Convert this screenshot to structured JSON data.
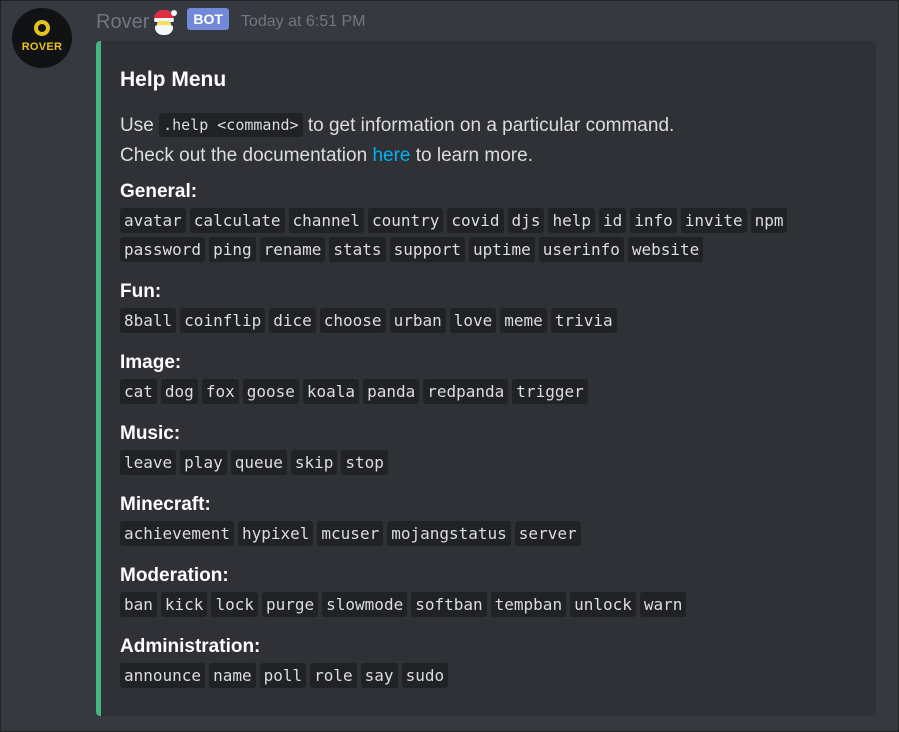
{
  "message": {
    "username": "Rover",
    "bot_tag": "BOT",
    "timestamp": "Today at 6:51 PM",
    "avatar_text": "ROVER",
    "colors": {
      "embed_bar": "#43b581",
      "bot_tag": "#7289da",
      "link": "#00b0f4",
      "avatar_accent": "#e7c21a"
    }
  },
  "embed": {
    "title": "Help Menu",
    "desc_line1_prefix": "Use ",
    "desc_line1_code": ".help <command>",
    "desc_line1_suffix": " to get information on a particular command.",
    "desc_line2_prefix": "Check out the documentation ",
    "desc_line2_link": "here",
    "desc_line2_suffix": " to learn more.",
    "sections": [
      {
        "title": "General:",
        "commands": [
          "avatar",
          "calculate",
          "channel",
          "country",
          "covid",
          "djs",
          "help",
          "id",
          "info",
          "invite",
          "npm",
          "password",
          "ping",
          "rename",
          "stats",
          "support",
          "uptime",
          "userinfo",
          "website"
        ]
      },
      {
        "title": "Fun:",
        "commands": [
          "8ball",
          "coinflip",
          "dice",
          "choose",
          "urban",
          "love",
          "meme",
          "trivia"
        ]
      },
      {
        "title": "Image:",
        "commands": [
          "cat",
          "dog",
          "fox",
          "goose",
          "koala",
          "panda",
          "redpanda",
          "trigger"
        ]
      },
      {
        "title": "Music:",
        "commands": [
          "leave",
          "play",
          "queue",
          "skip",
          "stop"
        ]
      },
      {
        "title": "Minecraft:",
        "commands": [
          "achievement",
          "hypixel",
          "mcuser",
          "mojangstatus",
          "server"
        ]
      },
      {
        "title": "Moderation:",
        "commands": [
          "ban",
          "kick",
          "lock",
          "purge",
          "slowmode",
          "softban",
          "tempban",
          "unlock",
          "warn"
        ]
      },
      {
        "title": "Administration:",
        "commands": [
          "announce",
          "name",
          "poll",
          "role",
          "say",
          "sudo"
        ]
      }
    ]
  }
}
